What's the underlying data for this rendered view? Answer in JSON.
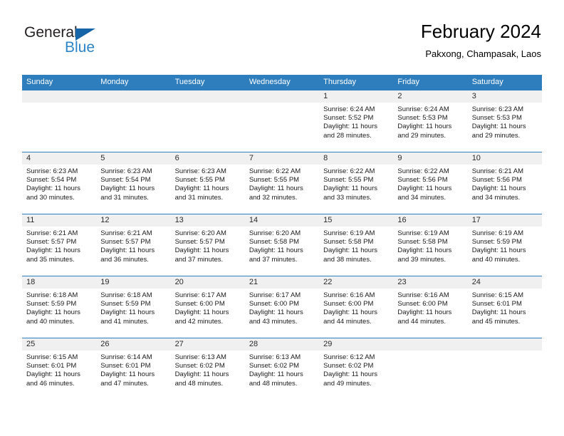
{
  "logo": {
    "word_one": "General",
    "word_two": "Blue",
    "triangle_color": "#1565a8",
    "blue_color": "#2e84c8"
  },
  "header": {
    "title": "February 2024",
    "subtitle": "Pakxong, Champasak, Laos"
  },
  "colors": {
    "header_bar": "#2e7ebd",
    "day_band": "#f0f0f0",
    "row_divider": "#2e7ebd"
  },
  "weekdays": [
    "Sunday",
    "Monday",
    "Tuesday",
    "Wednesday",
    "Thursday",
    "Friday",
    "Saturday"
  ],
  "weeks": [
    [
      {
        "day": "",
        "sunrise": "",
        "sunset": "",
        "daylight1": "",
        "daylight2": ""
      },
      {
        "day": "",
        "sunrise": "",
        "sunset": "",
        "daylight1": "",
        "daylight2": ""
      },
      {
        "day": "",
        "sunrise": "",
        "sunset": "",
        "daylight1": "",
        "daylight2": ""
      },
      {
        "day": "",
        "sunrise": "",
        "sunset": "",
        "daylight1": "",
        "daylight2": ""
      },
      {
        "day": "1",
        "sunrise": "Sunrise: 6:24 AM",
        "sunset": "Sunset: 5:52 PM",
        "daylight1": "Daylight: 11 hours",
        "daylight2": "and 28 minutes."
      },
      {
        "day": "2",
        "sunrise": "Sunrise: 6:24 AM",
        "sunset": "Sunset: 5:53 PM",
        "daylight1": "Daylight: 11 hours",
        "daylight2": "and 29 minutes."
      },
      {
        "day": "3",
        "sunrise": "Sunrise: 6:23 AM",
        "sunset": "Sunset: 5:53 PM",
        "daylight1": "Daylight: 11 hours",
        "daylight2": "and 29 minutes."
      }
    ],
    [
      {
        "day": "4",
        "sunrise": "Sunrise: 6:23 AM",
        "sunset": "Sunset: 5:54 PM",
        "daylight1": "Daylight: 11 hours",
        "daylight2": "and 30 minutes."
      },
      {
        "day": "5",
        "sunrise": "Sunrise: 6:23 AM",
        "sunset": "Sunset: 5:54 PM",
        "daylight1": "Daylight: 11 hours",
        "daylight2": "and 31 minutes."
      },
      {
        "day": "6",
        "sunrise": "Sunrise: 6:23 AM",
        "sunset": "Sunset: 5:55 PM",
        "daylight1": "Daylight: 11 hours",
        "daylight2": "and 31 minutes."
      },
      {
        "day": "7",
        "sunrise": "Sunrise: 6:22 AM",
        "sunset": "Sunset: 5:55 PM",
        "daylight1": "Daylight: 11 hours",
        "daylight2": "and 32 minutes."
      },
      {
        "day": "8",
        "sunrise": "Sunrise: 6:22 AM",
        "sunset": "Sunset: 5:55 PM",
        "daylight1": "Daylight: 11 hours",
        "daylight2": "and 33 minutes."
      },
      {
        "day": "9",
        "sunrise": "Sunrise: 6:22 AM",
        "sunset": "Sunset: 5:56 PM",
        "daylight1": "Daylight: 11 hours",
        "daylight2": "and 34 minutes."
      },
      {
        "day": "10",
        "sunrise": "Sunrise: 6:21 AM",
        "sunset": "Sunset: 5:56 PM",
        "daylight1": "Daylight: 11 hours",
        "daylight2": "and 34 minutes."
      }
    ],
    [
      {
        "day": "11",
        "sunrise": "Sunrise: 6:21 AM",
        "sunset": "Sunset: 5:57 PM",
        "daylight1": "Daylight: 11 hours",
        "daylight2": "and 35 minutes."
      },
      {
        "day": "12",
        "sunrise": "Sunrise: 6:21 AM",
        "sunset": "Sunset: 5:57 PM",
        "daylight1": "Daylight: 11 hours",
        "daylight2": "and 36 minutes."
      },
      {
        "day": "13",
        "sunrise": "Sunrise: 6:20 AM",
        "sunset": "Sunset: 5:57 PM",
        "daylight1": "Daylight: 11 hours",
        "daylight2": "and 37 minutes."
      },
      {
        "day": "14",
        "sunrise": "Sunrise: 6:20 AM",
        "sunset": "Sunset: 5:58 PM",
        "daylight1": "Daylight: 11 hours",
        "daylight2": "and 37 minutes."
      },
      {
        "day": "15",
        "sunrise": "Sunrise: 6:19 AM",
        "sunset": "Sunset: 5:58 PM",
        "daylight1": "Daylight: 11 hours",
        "daylight2": "and 38 minutes."
      },
      {
        "day": "16",
        "sunrise": "Sunrise: 6:19 AM",
        "sunset": "Sunset: 5:58 PM",
        "daylight1": "Daylight: 11 hours",
        "daylight2": "and 39 minutes."
      },
      {
        "day": "17",
        "sunrise": "Sunrise: 6:19 AM",
        "sunset": "Sunset: 5:59 PM",
        "daylight1": "Daylight: 11 hours",
        "daylight2": "and 40 minutes."
      }
    ],
    [
      {
        "day": "18",
        "sunrise": "Sunrise: 6:18 AM",
        "sunset": "Sunset: 5:59 PM",
        "daylight1": "Daylight: 11 hours",
        "daylight2": "and 40 minutes."
      },
      {
        "day": "19",
        "sunrise": "Sunrise: 6:18 AM",
        "sunset": "Sunset: 5:59 PM",
        "daylight1": "Daylight: 11 hours",
        "daylight2": "and 41 minutes."
      },
      {
        "day": "20",
        "sunrise": "Sunrise: 6:17 AM",
        "sunset": "Sunset: 6:00 PM",
        "daylight1": "Daylight: 11 hours",
        "daylight2": "and 42 minutes."
      },
      {
        "day": "21",
        "sunrise": "Sunrise: 6:17 AM",
        "sunset": "Sunset: 6:00 PM",
        "daylight1": "Daylight: 11 hours",
        "daylight2": "and 43 minutes."
      },
      {
        "day": "22",
        "sunrise": "Sunrise: 6:16 AM",
        "sunset": "Sunset: 6:00 PM",
        "daylight1": "Daylight: 11 hours",
        "daylight2": "and 44 minutes."
      },
      {
        "day": "23",
        "sunrise": "Sunrise: 6:16 AM",
        "sunset": "Sunset: 6:00 PM",
        "daylight1": "Daylight: 11 hours",
        "daylight2": "and 44 minutes."
      },
      {
        "day": "24",
        "sunrise": "Sunrise: 6:15 AM",
        "sunset": "Sunset: 6:01 PM",
        "daylight1": "Daylight: 11 hours",
        "daylight2": "and 45 minutes."
      }
    ],
    [
      {
        "day": "25",
        "sunrise": "Sunrise: 6:15 AM",
        "sunset": "Sunset: 6:01 PM",
        "daylight1": "Daylight: 11 hours",
        "daylight2": "and 46 minutes."
      },
      {
        "day": "26",
        "sunrise": "Sunrise: 6:14 AM",
        "sunset": "Sunset: 6:01 PM",
        "daylight1": "Daylight: 11 hours",
        "daylight2": "and 47 minutes."
      },
      {
        "day": "27",
        "sunrise": "Sunrise: 6:13 AM",
        "sunset": "Sunset: 6:02 PM",
        "daylight1": "Daylight: 11 hours",
        "daylight2": "and 48 minutes."
      },
      {
        "day": "28",
        "sunrise": "Sunrise: 6:13 AM",
        "sunset": "Sunset: 6:02 PM",
        "daylight1": "Daylight: 11 hours",
        "daylight2": "and 48 minutes."
      },
      {
        "day": "29",
        "sunrise": "Sunrise: 6:12 AM",
        "sunset": "Sunset: 6:02 PM",
        "daylight1": "Daylight: 11 hours",
        "daylight2": "and 49 minutes."
      },
      {
        "day": "",
        "sunrise": "",
        "sunset": "",
        "daylight1": "",
        "daylight2": ""
      },
      {
        "day": "",
        "sunrise": "",
        "sunset": "",
        "daylight1": "",
        "daylight2": ""
      }
    ]
  ]
}
